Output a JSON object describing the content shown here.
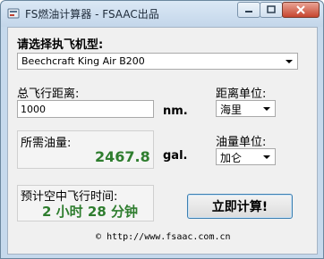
{
  "window": {
    "title": "FS燃油计算器 - FSAAC出品"
  },
  "aircraft": {
    "label": "请选择执飞机型:",
    "selected": "Beechcraft King Air B200"
  },
  "distance": {
    "label": "总飞行距离:",
    "value": "1000",
    "unit": "nm."
  },
  "distance_unit": {
    "label": "距离单位:",
    "selected": "海里"
  },
  "fuel": {
    "label": "所需油量:",
    "value": "2467.8",
    "unit": "gal."
  },
  "fuel_unit": {
    "label": "油量单位:",
    "selected": "加仑"
  },
  "flight_time": {
    "label": "预计空中飞行时间:",
    "value": "2 小时 28 分钟"
  },
  "calculate_button": {
    "label": "立即计算!"
  },
  "footer": {
    "url": "http://www.fsaac.com.cn",
    "bullet": "©"
  },
  "colors": {
    "result_green": "#2e7d2e",
    "title_bar": "#c6d9ec",
    "close_red": "#c6452f"
  }
}
